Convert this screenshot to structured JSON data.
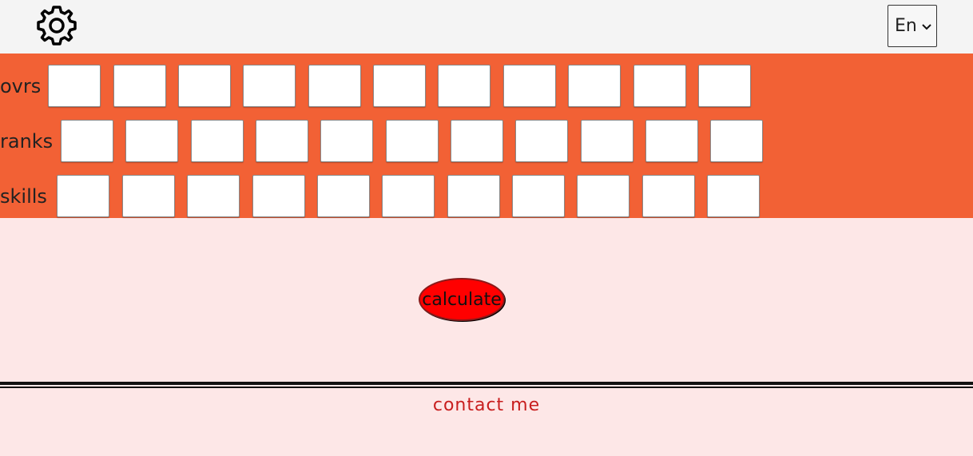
{
  "header": {
    "settings_icon": "gear-icon",
    "language": {
      "selected": "En",
      "chevron": "chevron-down-icon"
    }
  },
  "form": {
    "rows": [
      {
        "label": "ovrs",
        "cells": 11
      },
      {
        "label": "ranks",
        "cells": 11
      },
      {
        "label": "skills",
        "cells": 11
      }
    ]
  },
  "actions": {
    "calculate_label": "calculate"
  },
  "footer": {
    "contact_label": "contact me"
  },
  "colors": {
    "band": "#f26135",
    "page": "#fde7e7",
    "button": "#ff0000",
    "contact": "#c81e1e"
  }
}
